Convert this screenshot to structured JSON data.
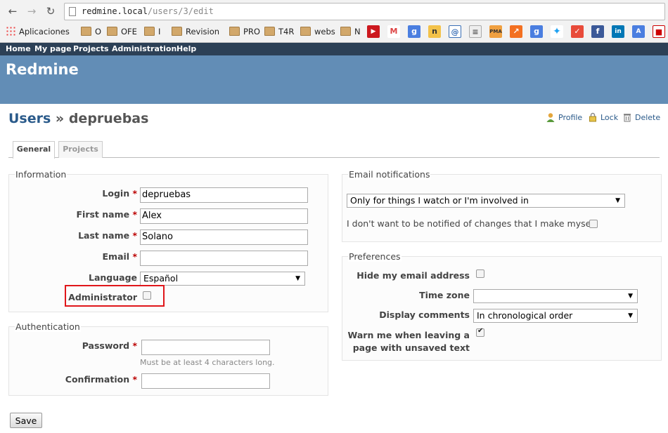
{
  "browser": {
    "url_host": "redmine.local",
    "url_path": "/users/3/edit",
    "bookmarks": [
      {
        "label": "Aplicaciones",
        "icon": "apps-grid-icon"
      },
      {
        "label": "O",
        "icon": "folder-icon"
      },
      {
        "label": "OFE",
        "icon": "folder-icon"
      },
      {
        "label": "I",
        "icon": "folder-icon"
      },
      {
        "label": "Revision",
        "icon": "folder-icon"
      },
      {
        "label": "PRO",
        "icon": "folder-icon"
      },
      {
        "label": "T4R",
        "icon": "folder-icon"
      },
      {
        "label": "webs",
        "icon": "folder-icon"
      },
      {
        "label": "N",
        "icon": "folder-icon"
      }
    ]
  },
  "top_menu": [
    "Home",
    "My page",
    "Projects",
    "Administration",
    "Help"
  ],
  "header": {
    "title": "Redmine"
  },
  "page": {
    "title_link": "Users",
    "title_sep": " » ",
    "title_user": "depruebas",
    "actions": [
      "Profile",
      "Lock",
      "Delete"
    ],
    "tabs": [
      "General",
      "Projects"
    ]
  },
  "information": {
    "legend": "Information",
    "login_label": "Login",
    "login_value": "depruebas",
    "firstname_label": "First name",
    "firstname_value": "Alex",
    "lastname_label": "Last name",
    "lastname_value": "Solano",
    "email_label": "Email",
    "email_value": "",
    "language_label": "Language",
    "language_value": "Español",
    "admin_label": "Administrator",
    "admin_checked": false,
    "required_marker": "*"
  },
  "authentication": {
    "legend": "Authentication",
    "password_label": "Password",
    "password_hint": "Must be at least 4 characters long.",
    "confirmation_label": "Confirmation"
  },
  "email_notifications": {
    "legend": "Email notifications",
    "selected": "Only for things I watch or I'm involved in",
    "no_self_label": "I don't want to be notified of changes that I make myself",
    "no_self_checked": false
  },
  "preferences": {
    "legend": "Preferences",
    "hide_mail_label": "Hide my email address",
    "hide_mail_checked": false,
    "timezone_label": "Time zone",
    "timezone_value": "",
    "comments_label": "Display comments",
    "comments_value": "In chronological order",
    "warn_label_line1": "Warn me when leaving a",
    "warn_label_line2": "page with unsaved text",
    "warn_checked": true
  },
  "form": {
    "save_label": "Save"
  },
  "colors": {
    "top_menu": "#2c4056",
    "header": "#628db6",
    "highlight": "#e0161a",
    "required": "#bb0000"
  }
}
